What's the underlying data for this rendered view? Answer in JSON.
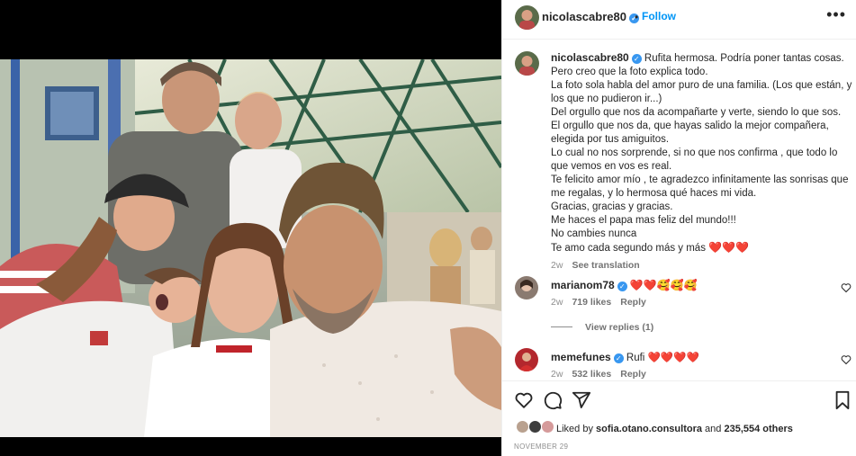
{
  "post": {
    "username": "nicolascabre80",
    "follow_label": "Follow",
    "dot": "•",
    "more": "•••"
  },
  "caption": {
    "username": "nicolascabre80",
    "lines": [
      "Rufita hermosa. Podría poner tantas cosas.",
      "Pero creo que la foto explica todo.",
      "La foto sola habla del amor puro de una familia. (Los que están, y",
      "los que no pudieron ir...)",
      "Del orgullo que nos da acompañarte y verte, siendo lo que sos.",
      "El orgullo que nos da, que hayas salido la mejor compañera,",
      "elegida por tus amiguitos.",
      "Lo cual no nos sorprende, si no que nos confirma , que todo lo",
      "que vemos en vos es real.",
      "Te felicito amor mío , te agradezco infinitamente las sonrisas que",
      "me regalas, y lo hermosa qué haces mi vida.",
      "Gracias, gracias y gracias.",
      "Me haces el papa mas feliz del mundo!!!",
      "No cambies nunca",
      "Te amo cada segundo más y más"
    ],
    "emoji_end": "❤️❤️❤️",
    "time": "2w",
    "see_translation": "See translation"
  },
  "comments": [
    {
      "username": "marianom78",
      "text": "❤️❤️🥰🥰🥰",
      "time": "2w",
      "likes": "719 likes",
      "reply": "Reply"
    },
    {
      "username": "memefunes",
      "text": "Rufi ❤️❤️❤️❤️",
      "time": "2w",
      "likes": "532 likes",
      "reply": "Reply"
    }
  ],
  "view_replies": "View replies (1)",
  "footer": {
    "liked_by_prefix": "Liked by ",
    "liked_by_user": "sofia.otano.consultora",
    "liked_by_mid": " and ",
    "liked_by_count": "235,554 others",
    "date": "NOVEMBER 29"
  },
  "colors": {
    "accent": "#0095f6",
    "verified": "#3897f0",
    "heart": "#ed1c24",
    "muted": "#8e8e8e"
  },
  "icons": [
    "heart-icon",
    "comment-icon",
    "share-icon",
    "bookmark-icon",
    "more-icon",
    "verified-icon"
  ]
}
